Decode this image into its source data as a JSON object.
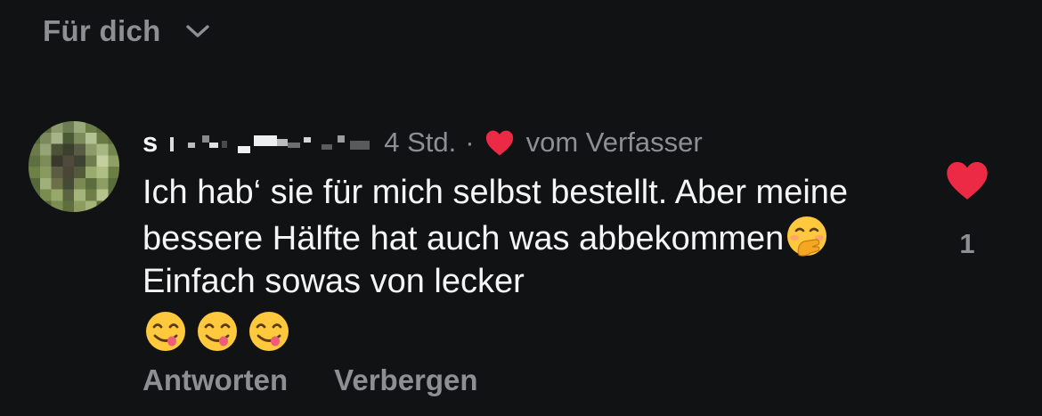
{
  "feed": {
    "filter_label": "Für dich",
    "filter_icon": "chevron-down-icon"
  },
  "comment": {
    "username_initial": "s",
    "username_obscured": true,
    "timestamp": "4 Std.",
    "separator": "·",
    "author_like_label": "vom Verfasser",
    "text_line_1": "Ich hab‘ sie für mich selbst bestellt. Aber meine bessere Hälfte hat auch was abbekommen",
    "text_line_2": "Einfach sowas von lecker",
    "emojis_inline": [
      "face-with-hand-over-mouth"
    ],
    "emojis_trailing": [
      "face-savoring-food",
      "face-savoring-food",
      "face-savoring-food"
    ],
    "like_count": "1",
    "actions": {
      "reply": "Antworten",
      "hide": "Verbergen"
    }
  },
  "colors": {
    "background": "#111214",
    "text_primary": "#f5f5f5",
    "text_secondary": "#8e8e93",
    "like_red": "#ed2a45"
  }
}
